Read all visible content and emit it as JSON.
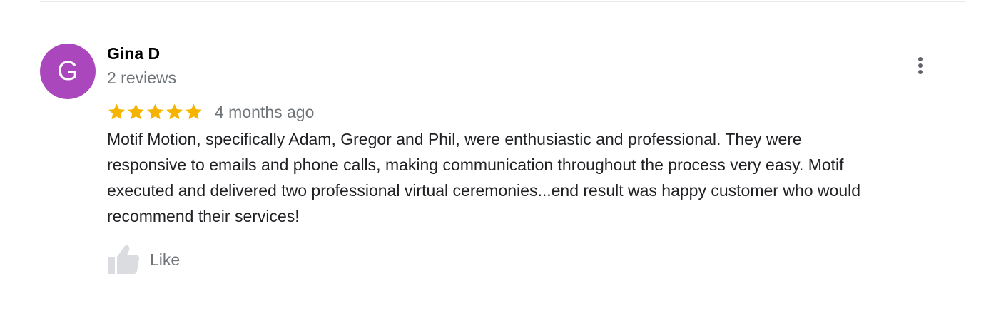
{
  "review": {
    "avatar_letter": "G",
    "avatar_color": "#ab47bc",
    "reviewer_name": "Gina D",
    "review_count": "2 reviews",
    "rating": 5,
    "rating_max": 5,
    "star_color": "#f4b400",
    "time_ago": "4 months ago",
    "lines": [
      "Motif Motion, specifically Adam, Gregor and Phil, were enthusiastic and professional. They were",
      "responsive to emails and phone calls, making communication throughout the process very easy. Motif",
      "executed and delivered two professional virtual ceremonies...end result was happy customer who would",
      "recommend their services!"
    ],
    "like_label": "Like",
    "like_icon": "thumbs-up-icon",
    "more_icon": "more-vertical-icon"
  }
}
